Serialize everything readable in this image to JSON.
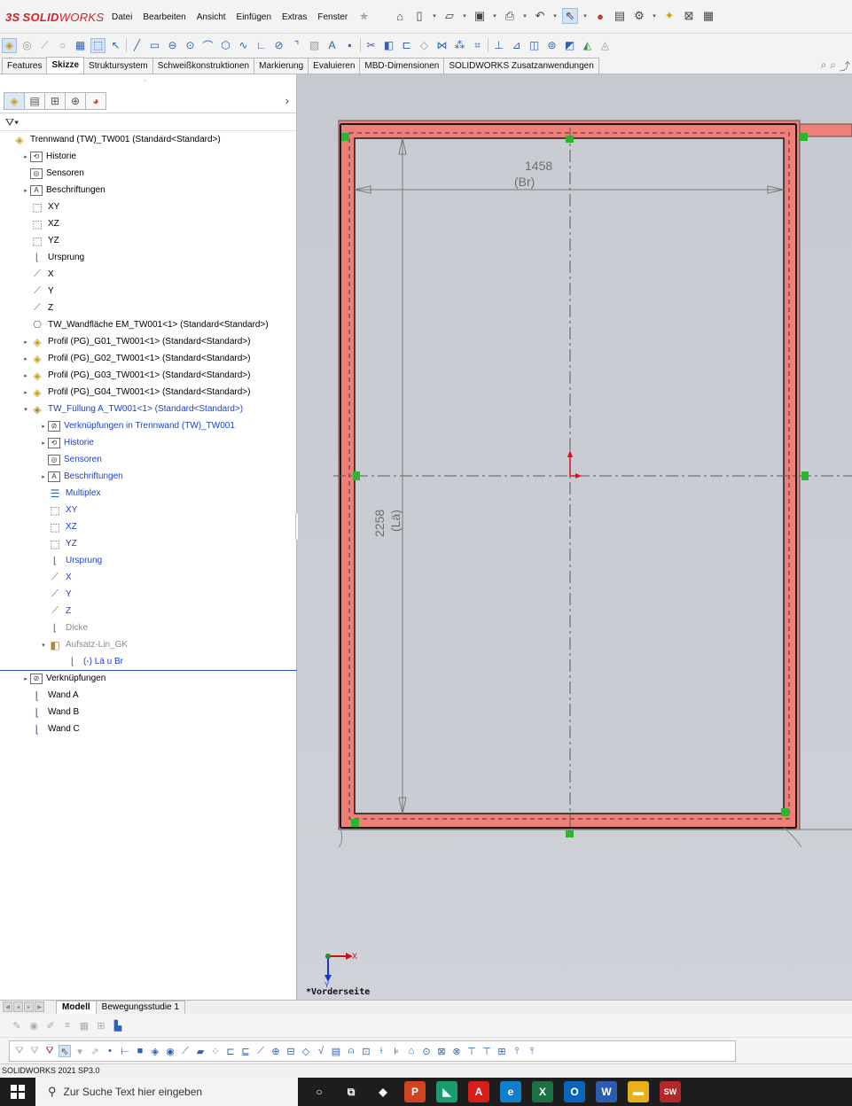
{
  "app": {
    "logo_prefix": "3S",
    "logo_solid": "SOLID",
    "logo_works": "WORKS",
    "menu": [
      "Datei",
      "Bearbeiten",
      "Ansicht",
      "Einfügen",
      "Extras",
      "Fenster"
    ]
  },
  "command_tabs": [
    {
      "label": "Features",
      "active": false
    },
    {
      "label": "Skizze",
      "active": true
    },
    {
      "label": "Struktursystem",
      "active": false
    },
    {
      "label": "Schweißkonstruktionen",
      "active": false
    },
    {
      "label": "Markierung",
      "active": false
    },
    {
      "label": "Evaluieren",
      "active": false
    },
    {
      "label": "MBD-Dimensionen",
      "active": false
    },
    {
      "label": "SOLIDWORKS Zusatzanwendungen",
      "active": false
    }
  ],
  "feature_tree": {
    "filter_icon": "filter-icon",
    "items": [
      {
        "label": "Trennwand (TW)_TW001  (Standard<Standard>)",
        "indent": 0,
        "twisty": "",
        "icon": "assembly-icon",
        "style": "normal"
      },
      {
        "label": "Historie",
        "indent": 1,
        "twisty": "▸",
        "icon": "history-icon",
        "style": "normal"
      },
      {
        "label": "Sensoren",
        "indent": 1,
        "twisty": "",
        "icon": "sensor-icon",
        "style": "normal"
      },
      {
        "label": "Beschriftungen",
        "indent": 1,
        "twisty": "▸",
        "icon": "annotation-icon",
        "style": "normal"
      },
      {
        "label": "XY",
        "indent": 1,
        "twisty": "",
        "icon": "plane-icon",
        "style": "normal"
      },
      {
        "label": "XZ",
        "indent": 1,
        "twisty": "",
        "icon": "plane-icon",
        "style": "normal"
      },
      {
        "label": "YZ",
        "indent": 1,
        "twisty": "",
        "icon": "plane-icon",
        "style": "normal"
      },
      {
        "label": "Ursprung",
        "indent": 1,
        "twisty": "",
        "icon": "origin-icon",
        "style": "normal"
      },
      {
        "label": "X",
        "indent": 1,
        "twisty": "",
        "icon": "axis-icon",
        "style": "normal"
      },
      {
        "label": "Y",
        "indent": 1,
        "twisty": "",
        "icon": "axis-icon",
        "style": "normal"
      },
      {
        "label": "Z",
        "indent": 1,
        "twisty": "",
        "icon": "axis-icon",
        "style": "normal"
      },
      {
        "label": "TW_Wandfläche EM_TW001<1> (Standard<Standard>)",
        "indent": 1,
        "twisty": "",
        "icon": "sketch-part-icon",
        "style": "normal"
      },
      {
        "label": "Profil (PG)_G01_TW001<1> (Standard<Standard>)",
        "indent": 1,
        "twisty": "▸",
        "icon": "part-icon",
        "style": "normal"
      },
      {
        "label": "Profil (PG)_G02_TW001<1> (Standard<Standard>)",
        "indent": 1,
        "twisty": "▸",
        "icon": "part-icon",
        "style": "normal"
      },
      {
        "label": "Profil (PG)_G03_TW001<1> (Standard<Standard>)",
        "indent": 1,
        "twisty": "▸",
        "icon": "part-icon",
        "style": "normal"
      },
      {
        "label": "Profil (PG)_G04_TW001<1> (Standard<Standard>)",
        "indent": 1,
        "twisty": "▸",
        "icon": "part-icon",
        "style": "normal"
      },
      {
        "label": "TW_Füllung A_TW001<1> (Standard<Standard>)",
        "indent": 1,
        "twisty": "▾",
        "icon": "part-edit-icon",
        "style": "blue"
      },
      {
        "label": "Verknüpfungen in Trennwand (TW)_TW001",
        "indent": 2,
        "twisty": "▸",
        "icon": "mates-icon",
        "style": "blue"
      },
      {
        "label": "Historie",
        "indent": 2,
        "twisty": "▸",
        "icon": "history-icon",
        "style": "blue"
      },
      {
        "label": "Sensoren",
        "indent": 2,
        "twisty": "",
        "icon": "sensor-icon",
        "style": "blue"
      },
      {
        "label": "Beschriftungen",
        "indent": 2,
        "twisty": "▸",
        "icon": "annotation-icon",
        "style": "blue"
      },
      {
        "label": "Multiplex",
        "indent": 2,
        "twisty": "",
        "icon": "material-icon",
        "style": "blue"
      },
      {
        "label": "XY",
        "indent": 2,
        "twisty": "",
        "icon": "plane-icon",
        "style": "blue"
      },
      {
        "label": "XZ",
        "indent": 2,
        "twisty": "",
        "icon": "plane-icon",
        "style": "blue"
      },
      {
        "label": "YZ",
        "indent": 2,
        "twisty": "",
        "icon": "plane-icon",
        "style": "blue"
      },
      {
        "label": "Ursprung",
        "indent": 2,
        "twisty": "",
        "icon": "origin-icon",
        "style": "blue"
      },
      {
        "label": "X",
        "indent": 2,
        "twisty": "",
        "icon": "axis-icon",
        "style": "blue"
      },
      {
        "label": "Y",
        "indent": 2,
        "twisty": "",
        "icon": "axis-icon",
        "style": "blue"
      },
      {
        "label": "Z",
        "indent": 2,
        "twisty": "",
        "icon": "axis-icon",
        "style": "blue"
      },
      {
        "label": "Dicke",
        "indent": 2,
        "twisty": "",
        "icon": "sketch-icon",
        "style": "grey"
      },
      {
        "label": "Aufsatz-Lin_GK",
        "indent": 2,
        "twisty": "▾",
        "icon": "extrude-icon",
        "style": "grey"
      },
      {
        "label": "(-) Lä u Br",
        "indent": 3,
        "twisty": "",
        "icon": "sketch-icon",
        "style": "blue"
      },
      {
        "label": "Verknüpfungen",
        "indent": 1,
        "twisty": "▸",
        "icon": "mates-icon",
        "style": "normal"
      },
      {
        "label": "Wand A",
        "indent": 1,
        "twisty": "",
        "icon": "wall-sketch-icon",
        "style": "normal"
      },
      {
        "label": "Wand B",
        "indent": 1,
        "twisty": "",
        "icon": "wall-sketch-icon",
        "style": "normal"
      },
      {
        "label": "Wand C",
        "indent": 1,
        "twisty": "",
        "icon": "wall-sketch-icon",
        "style": "normal"
      }
    ]
  },
  "graphics": {
    "dim_width_value": "1458",
    "dim_width_label": "(Br)",
    "dim_height_value": "2258",
    "dim_height_label": "(Lä)",
    "triad_x": "X",
    "triad_y": "Y",
    "view_name": "*Vorderseite",
    "colors": {
      "fill": "#f08077",
      "sketch": "#1a1a1a",
      "relation": "#2db52d",
      "origin": "#e01010"
    }
  },
  "bottom_tabs": [
    {
      "label": "Modell",
      "active": true
    },
    {
      "label": "Bewegungsstudie 1",
      "active": false
    }
  ],
  "status_bar": "SOLIDWORKS 2021 SP3.0",
  "taskbar": {
    "search_placeholder": "Zur Suche Text hier eingeben",
    "apps": [
      {
        "name": "cortana-icon",
        "glyph": "○",
        "color": "transparent"
      },
      {
        "name": "task-view-icon",
        "glyph": "⧉",
        "color": "transparent"
      },
      {
        "name": "app-icon-1",
        "glyph": "◆",
        "color": "transparent"
      },
      {
        "name": "powerpoint-icon",
        "glyph": "P",
        "color": "#d04423"
      },
      {
        "name": "app-icon-2",
        "glyph": "◣",
        "color": "#1b9c6d"
      },
      {
        "name": "acrobat-icon",
        "glyph": "A",
        "color": "#d7201c"
      },
      {
        "name": "edge-icon",
        "glyph": "e",
        "color": "#0f7fc8"
      },
      {
        "name": "excel-icon",
        "glyph": "X",
        "color": "#1d7044"
      },
      {
        "name": "outlook-icon",
        "glyph": "O",
        "color": "#0a64b8"
      },
      {
        "name": "word-icon",
        "glyph": "W",
        "color": "#2b5cb0"
      },
      {
        "name": "file-explorer-icon",
        "glyph": "▬",
        "color": "#e8b21c"
      },
      {
        "name": "solidworks-taskbar-icon",
        "glyph": "SW",
        "color": "#b3282c"
      }
    ]
  }
}
